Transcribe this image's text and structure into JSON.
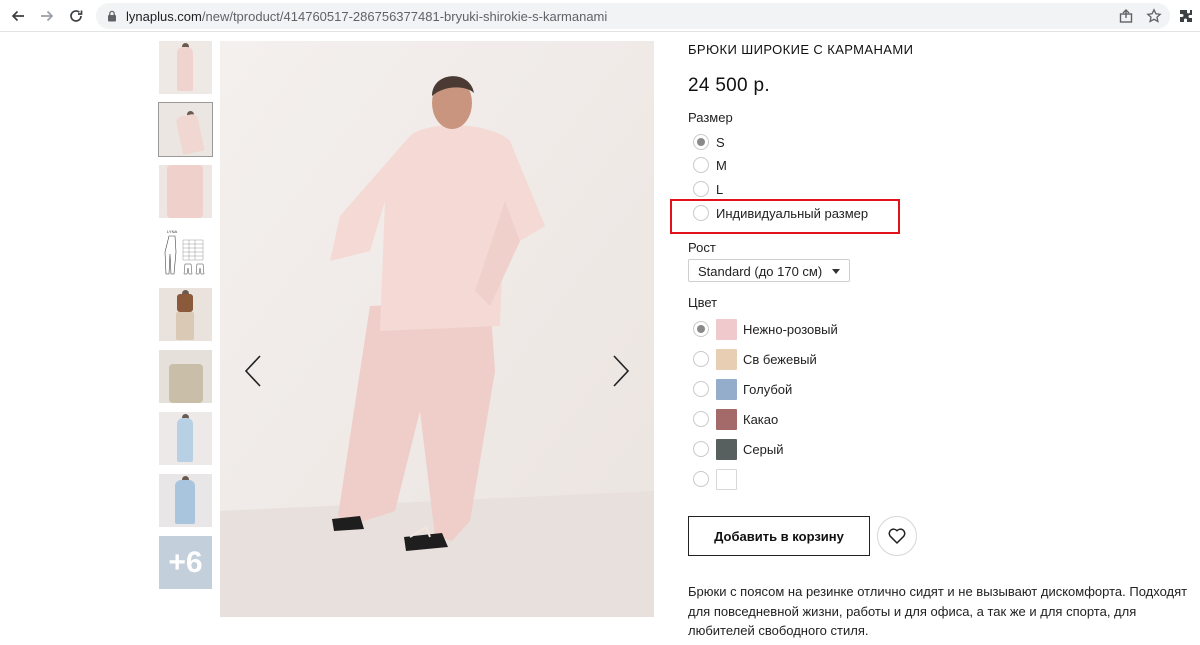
{
  "browser": {
    "url_host": "lynaplus.com",
    "url_path": "/new/tproduct/414760517-286756377481-bryuki-shirokie-s-karmanami",
    "icons": [
      "back-icon",
      "forward-icon",
      "reload-icon",
      "lock-icon",
      "share-icon",
      "star-icon",
      "extensions-icon"
    ]
  },
  "gallery": {
    "thumbnails": [
      {
        "label": ""
      },
      {
        "label": ""
      },
      {
        "label": ""
      },
      {
        "label": ""
      },
      {
        "label": ""
      },
      {
        "label": ""
      },
      {
        "label": ""
      },
      {
        "label": ""
      },
      {
        "label": "+6"
      }
    ],
    "active_index": 1,
    "prev_icon": "chevron-left-icon",
    "next_icon": "chevron-right-icon"
  },
  "product": {
    "title": "БРЮКИ ШИРОКИЕ С КАРМАНАМИ",
    "price": "24 500 р.",
    "size_label": "Размер",
    "sizes": [
      "S",
      "M",
      "L",
      "Индивидуальный размер"
    ],
    "selected_size": "S",
    "height_label": "Рост",
    "height_value": "Standard (до 170 см)",
    "color_label": "Цвет",
    "colors": [
      {
        "name": "Нежно-розовый",
        "hex": "#efc9cb"
      },
      {
        "name": "Св бежевый",
        "hex": "#e8cfb3"
      },
      {
        "name": "Голубой",
        "hex": "#94adcb"
      },
      {
        "name": "Какао",
        "hex": "#a46a69"
      },
      {
        "name": "Серый",
        "hex": "#585f5f"
      },
      {
        "name": "",
        "hex": "#ffffff"
      }
    ],
    "selected_color": "Нежно-розовый",
    "add_to_cart": "Добавить в корзину",
    "favorite_icon": "heart-icon",
    "description": "Брюки с поясом на резинке отлично сидят и не вызывают дискомфорта. Подходят для повседневной жизни, работы и для офиса, а так же и для спорта, для любителей свободного стиля."
  },
  "colors": {
    "highlight": "#e0131a",
    "radio_checked": "#8a8a8a"
  }
}
